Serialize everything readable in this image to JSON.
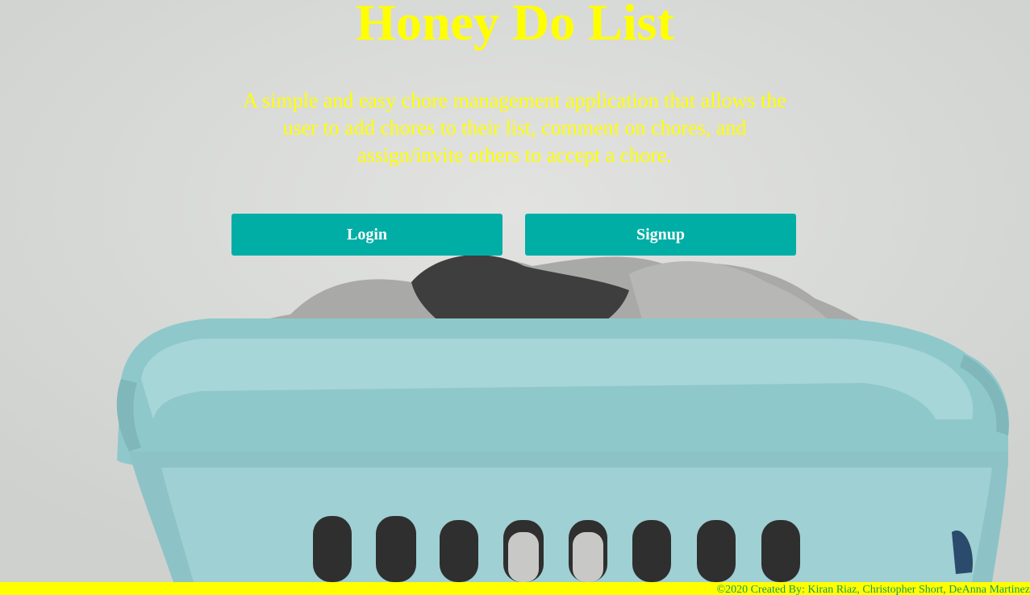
{
  "header": {
    "title": "Honey Do List"
  },
  "hero": {
    "description": "A simple and easy chore management application that allows the user to add chores to their list, comment on chores, and assign/invite others to accept a chore."
  },
  "actions": {
    "login_label": "Login",
    "signup_label": "Signup"
  },
  "footer": {
    "copyright": "©2020 Created By: Kiran Riaz, Christopher Short, DeAnna Martinez"
  },
  "colors": {
    "title": "#ffff00",
    "button": "#00aea6",
    "footer_bg": "#ffff00",
    "footer_text": "#1d9a55"
  },
  "background_image": "laundry-basket-photo"
}
